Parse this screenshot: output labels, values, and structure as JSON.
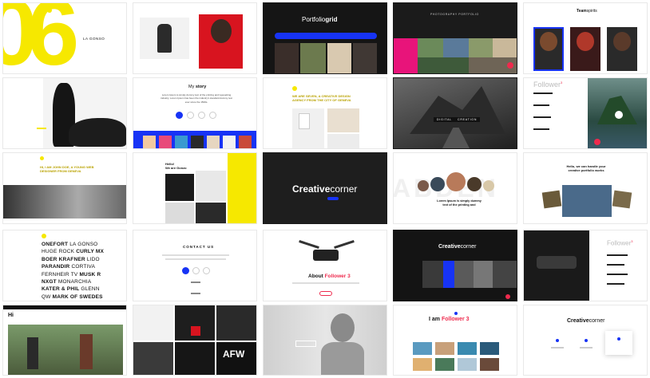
{
  "colors": {
    "yellow": "#f6e800",
    "blue": "#1733f5",
    "pink": "#ee2a4d",
    "dark": "#1a1a1a"
  },
  "t1": {
    "big": "06",
    "brand": "LA GONSO"
  },
  "t3": {
    "title_a": "Portfolio",
    "title_b": "grid"
  },
  "t4": {
    "heading": "PHOTOGRAPHY PORTFOLIO"
  },
  "t5": {
    "title_a": "Team",
    "title_b": "spirits"
  },
  "t7": {
    "heading_a": "My ",
    "heading_b": "story",
    "body": "Lorem Ipsum is simply dummy text of the printing and typesetting industry. Lorem Ipsum has been the industry's standard dummy text ever since the 1500s."
  },
  "t8": {
    "text": "WE ARE SEVEN, A CREATIVE DESIGN AGENCY FROM THE CITY OF GENEVA"
  },
  "t9": {
    "btn1": "DIGITAL",
    "btn2": "CREATION"
  },
  "t10": {
    "title_a": "Follower",
    "title_b": "3"
  },
  "t11": {
    "text": "HI, I AM JOHN DOE, A YOUNG WEB DESIGNER FROM GENEVA"
  },
  "t12": {
    "hello": "Hello!",
    "sub": "We are Gonzo"
  },
  "t13": {
    "title_a": "Creative",
    "title_b": "corner"
  },
  "t14": {
    "bg_word": "ABDEN",
    "text": "Lorem Ipsum is simply dummy text of the printing and"
  },
  "t15": {
    "text": "Hello, we can handle your creative portfolio works"
  },
  "t16": {
    "rows": [
      {
        "a": "ONEFORT",
        "b": "LA GONSO"
      },
      {
        "a": "HUGE ROCK",
        "b": "CURLY MX"
      },
      {
        "a": "BOER KRAFNER",
        "b": "LIDO"
      },
      {
        "a": "PARANDIR",
        "b": "CORTIVA"
      },
      {
        "a": "FERNHEIR TV",
        "b": "MUSK R"
      },
      {
        "a": "NXGT",
        "b": "MONARCHIA"
      },
      {
        "a": "KATER & PHIL",
        "b": "GLENN"
      },
      {
        "a": "QW",
        "b": "MARK OF SWEDES"
      }
    ]
  },
  "t17": {
    "heading": "CONTACT US"
  },
  "t18": {
    "title_a": "About ",
    "title_b": "Follower 3"
  },
  "t19": {
    "title_a": "Creative",
    "title_b": "corner"
  },
  "t20": {
    "title_a": "Follower",
    "title_b": "3"
  },
  "t21": {
    "hi": "Hi"
  },
  "t22": {
    "word": "AFW"
  },
  "t24": {
    "title_a": "I am ",
    "title_b": "Follower 3"
  },
  "t25": {
    "title_a": "Creative",
    "title_b": "corner"
  }
}
